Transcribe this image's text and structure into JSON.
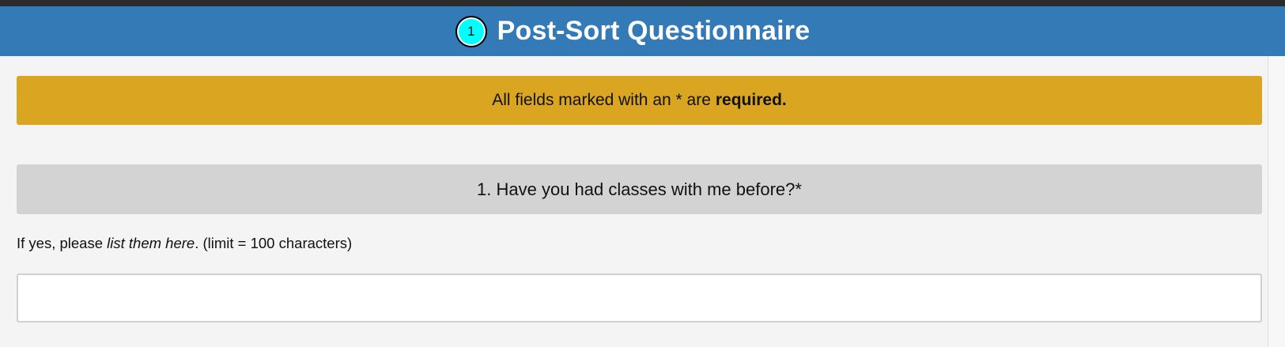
{
  "header": {
    "step_number": "1",
    "title": "Post-Sort Questionnaire",
    "background_color": "#337ab7",
    "badge_color": "#00ffff"
  },
  "notice": {
    "text_before": "All fields marked with an * are",
    "text_emphasis": "required.",
    "background_color": "#daa520"
  },
  "question": {
    "label": "1. Have you had classes with me before?*",
    "instruction_prefix": "If yes, please ",
    "instruction_italic": "list them here",
    "instruction_suffix": ". (limit = 100 characters)",
    "answer_value": "",
    "answer_placeholder": ""
  }
}
